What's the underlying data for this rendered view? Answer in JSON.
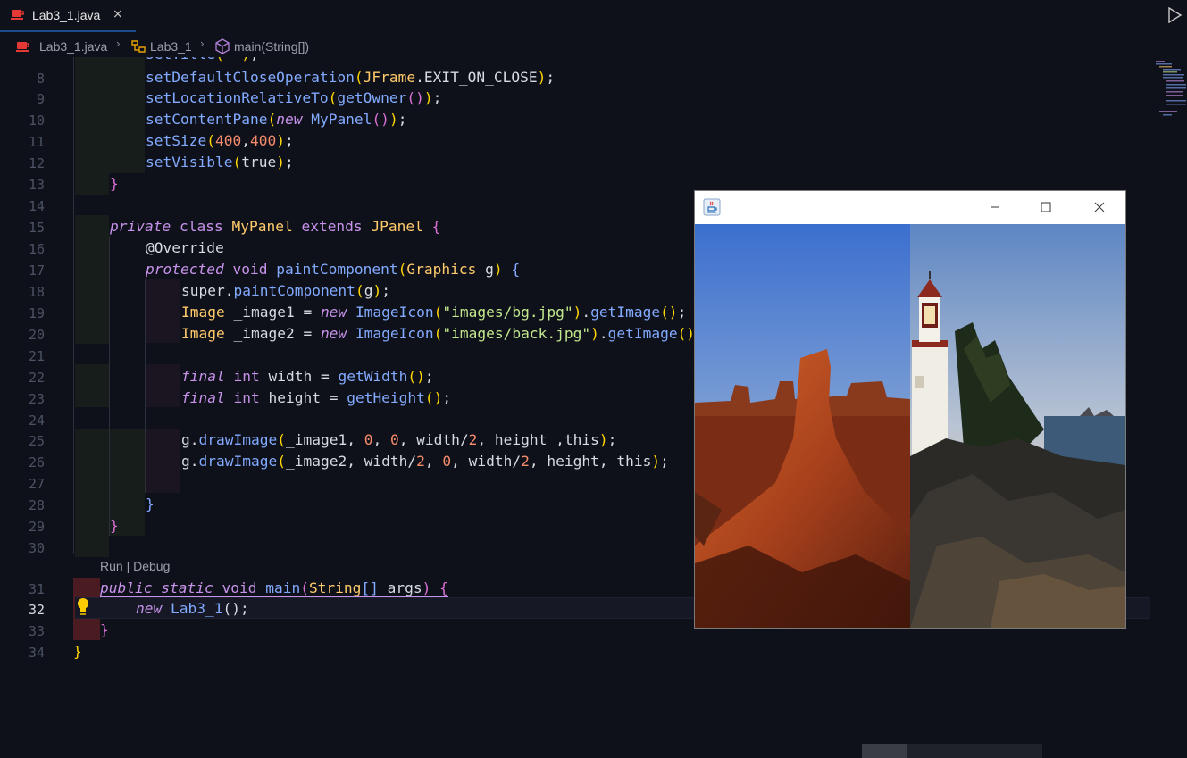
{
  "tab": {
    "label": "Lab3_1.java",
    "close_glyph": "×",
    "icon": "java-cup-icon"
  },
  "toolbar": {
    "run_icon": "run-triangle-icon"
  },
  "breadcrumb": {
    "items": [
      {
        "label": "Lab3_1.java",
        "icon": "java-cup-icon"
      },
      {
        "label": "Lab3_1",
        "icon": "class-icon"
      },
      {
        "label": "main(String[])",
        "icon": "method-cube-icon"
      }
    ],
    "separator": "›"
  },
  "editor": {
    "codelens": "Run | Debug",
    "current_line": "32",
    "lines": [
      {
        "n": "8",
        "text": "setDefaultCloseOperation(JFrame.EXIT_ON_CLOSE);"
      },
      {
        "n": "9",
        "text": "setLocationRelativeTo(getOwner());"
      },
      {
        "n": "10",
        "text": "setContentPane(new MyPanel());"
      },
      {
        "n": "11",
        "text": "setSize(400,400);"
      },
      {
        "n": "12",
        "text": "setVisible(true);"
      },
      {
        "n": "13",
        "text": "}"
      },
      {
        "n": "14",
        "text": ""
      },
      {
        "n": "15",
        "text": "private class MyPanel extends JPanel {"
      },
      {
        "n": "16",
        "text": "@Override"
      },
      {
        "n": "17",
        "text": "protected void paintComponent(Graphics g) {"
      },
      {
        "n": "18",
        "text": "super.paintComponent(g);"
      },
      {
        "n": "19",
        "text": "Image _image1 = new ImageIcon(\"images/bg.jpg\").getImage();"
      },
      {
        "n": "20",
        "text": "Image _image2 = new ImageIcon(\"images/back.jpg\").getImage();"
      },
      {
        "n": "21",
        "text": ""
      },
      {
        "n": "22",
        "text": "final int width = getWidth();"
      },
      {
        "n": "23",
        "text": "final int height = getHeight();"
      },
      {
        "n": "24",
        "text": ""
      },
      {
        "n": "25",
        "text": "g.drawImage(_image1, 0, 0, width/2, height ,this);"
      },
      {
        "n": "26",
        "text": "g.drawImage(_image2, width/2, 0, width/2, height, this);"
      },
      {
        "n": "27",
        "text": ""
      },
      {
        "n": "28",
        "text": "}"
      },
      {
        "n": "29",
        "text": "}"
      },
      {
        "n": "30",
        "text": ""
      },
      {
        "n": "31",
        "text": "public static void main(String[] args) {"
      },
      {
        "n": "32",
        "text": "new Lab3_1();"
      },
      {
        "n": "33",
        "text": "}"
      },
      {
        "n": "34",
        "text": "}"
      }
    ]
  },
  "java_window": {
    "title": "",
    "icon": "java-app-icon",
    "controls": [
      "minimize-icon",
      "maximize-icon",
      "close-icon"
    ],
    "left_image": "desert-butte",
    "right_image": "lighthouse-coast"
  },
  "colors": {
    "background": "#0f111a",
    "keyword": "#c792ea",
    "type": "#ffcb6b",
    "function": "#82aaff",
    "string": "#c3e88d",
    "number": "#f78c6c",
    "line_number": "#4b5263"
  }
}
